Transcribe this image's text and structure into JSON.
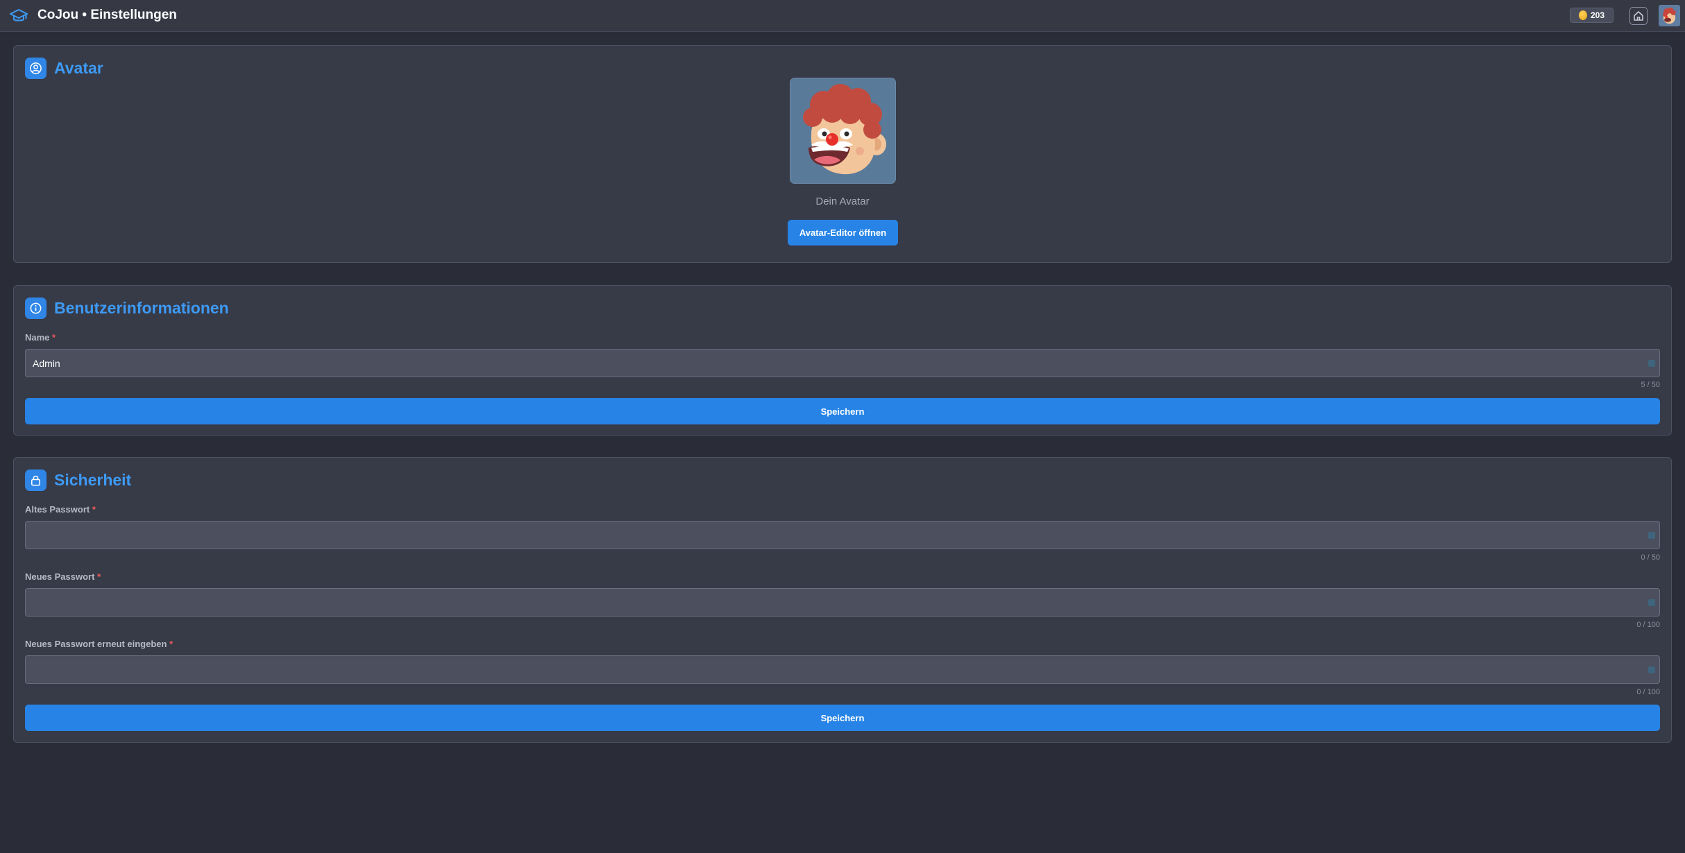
{
  "header": {
    "title": "CoJou • Einstellungen",
    "coins": "203",
    "brand_icon": "graduation-cap-icon",
    "coin_icon": "coin-icon",
    "home_icon": "home-icon"
  },
  "avatar_section": {
    "title": "Avatar",
    "icon": "user-circle-icon",
    "caption": "Dein Avatar",
    "editor_button": "Avatar-Editor öffnen"
  },
  "user_info": {
    "title": "Benutzerinformationen",
    "icon": "info-icon",
    "name_label": "Name",
    "required_mark": "*",
    "name_value": "Admin",
    "name_counter": "5 / 50",
    "save_label": "Speichern"
  },
  "security": {
    "title": "Sicherheit",
    "icon": "lock-icon",
    "required_mark": "*",
    "old_password_label": "Altes Passwort",
    "old_password_counter": "0 / 50",
    "new_password_label": "Neues Passwort",
    "new_password_counter": "0 / 100",
    "repeat_password_label": "Neues Passwort erneut eingeben",
    "repeat_password_counter": "0 / 100",
    "save_label": "Speichern"
  },
  "colors": {
    "accent": "#2784e6",
    "title_blue": "#3d9af5",
    "background": "#2a2d38",
    "card": "#373a47",
    "required": "#f05a5a"
  }
}
